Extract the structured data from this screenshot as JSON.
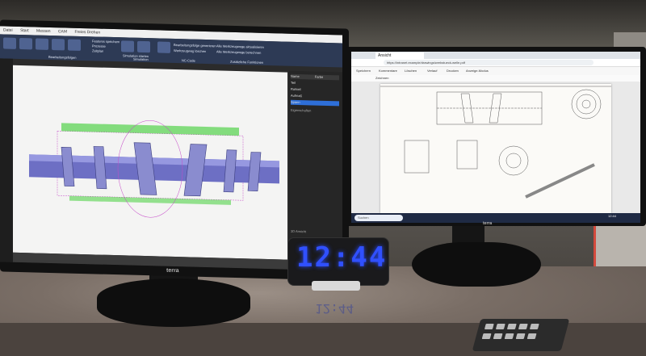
{
  "scene": {
    "description_tag": "",
    "clock": {
      "time": "12:44"
    }
  },
  "monitor_left": {
    "brand": "terra",
    "cad": {
      "menu": [
        "Datei",
        "Start",
        "Messen",
        "CAM",
        "Freies Drehen"
      ],
      "ribbon_groups": [
        "Bearbeitungsfolgen",
        "Simulation",
        "NC-Code",
        "Zusätzliche Funktionen"
      ],
      "ribbon_labels": [
        "Features speichern",
        "Prozesse",
        "Zeitplan",
        "Simulation starten",
        "Werkzeugwege",
        "Postprozessor",
        "Bearbeitungsfolge generieren",
        "Werkzeugweg löschen",
        "Alle Werkzeugwege aktualisieren",
        "Alle Werkzeugwege berechnen"
      ],
      "tree_columns": [
        "Name",
        "Farbe"
      ],
      "tree_rows": [
        "Teil",
        "Rohteil",
        "Aufmaß",
        "Spann"
      ],
      "panel_title": "Eigenschaften",
      "panel_footer": "3D Ansicht"
    }
  },
  "monitor_right": {
    "brand": "terra",
    "browser": {
      "tab_title": "Ansicht",
      "url": "https://intranet.example/drawings/werkstueck-welle.pdf",
      "toolbar": [
        "Speichern",
        "Kommentare",
        "Löschen",
        "Verlauf",
        "Drucken",
        "Anzeige-Modus"
      ],
      "pdf_toolbar": "Zeichnen",
      "taskbar_search": "Suchen",
      "taskbar_time": "12:44"
    }
  },
  "colors": {
    "clock_led": "#3050ff",
    "cad_background": "#f4f4f3",
    "ribbon": "#2d3a55",
    "taskbar": "#1f2a44"
  }
}
